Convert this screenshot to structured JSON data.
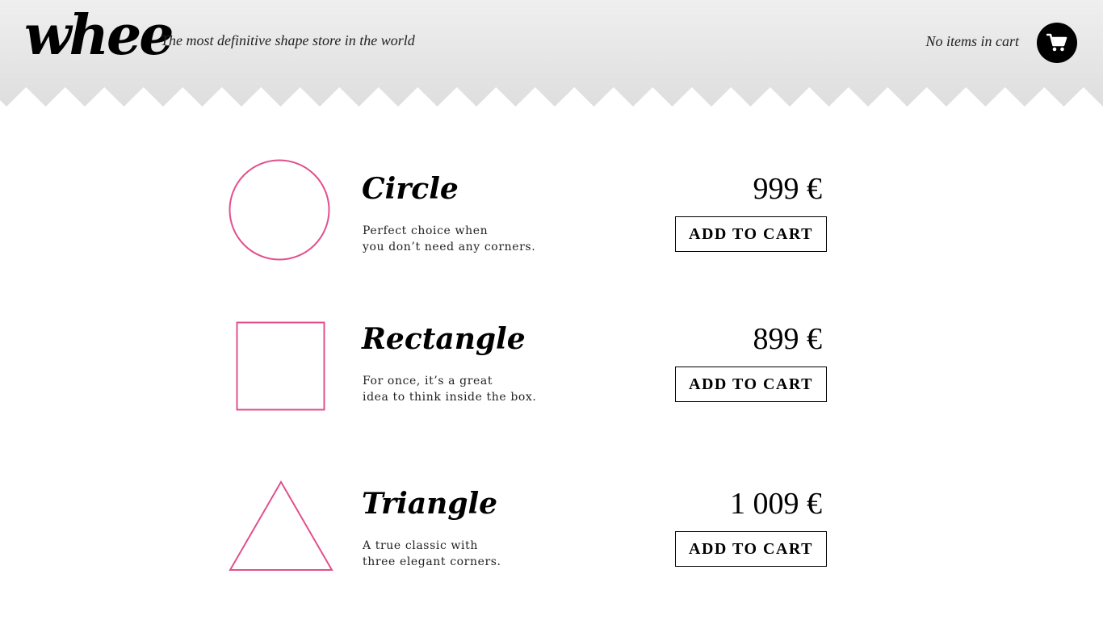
{
  "header": {
    "logo": "whee",
    "tagline": "The most definitive shape store in the world",
    "cart_status": "No items in cart",
    "cart_icon": "shopping-cart-icon"
  },
  "colors": {
    "accent": "#e2508c",
    "header_bg_top": "#efefef",
    "header_bg_bottom": "#e0e0e0",
    "text": "#000000"
  },
  "products": [
    {
      "name": "Circle",
      "description_line1": "Perfect choice when",
      "description_line2": "you don’t need any corners.",
      "price": "999 €",
      "button_label": "ADD TO CART",
      "shape": "circle"
    },
    {
      "name": "Rectangle",
      "description_line1": "For once, it’s a great",
      "description_line2": "idea to think inside the box.",
      "price": "899 €",
      "button_label": "ADD TO CART",
      "shape": "rectangle"
    },
    {
      "name": "Triangle",
      "description_line1": "A true classic with",
      "description_line2": "three elegant corners.",
      "price": "1 009 €",
      "button_label": "ADD TO CART",
      "shape": "triangle"
    }
  ]
}
